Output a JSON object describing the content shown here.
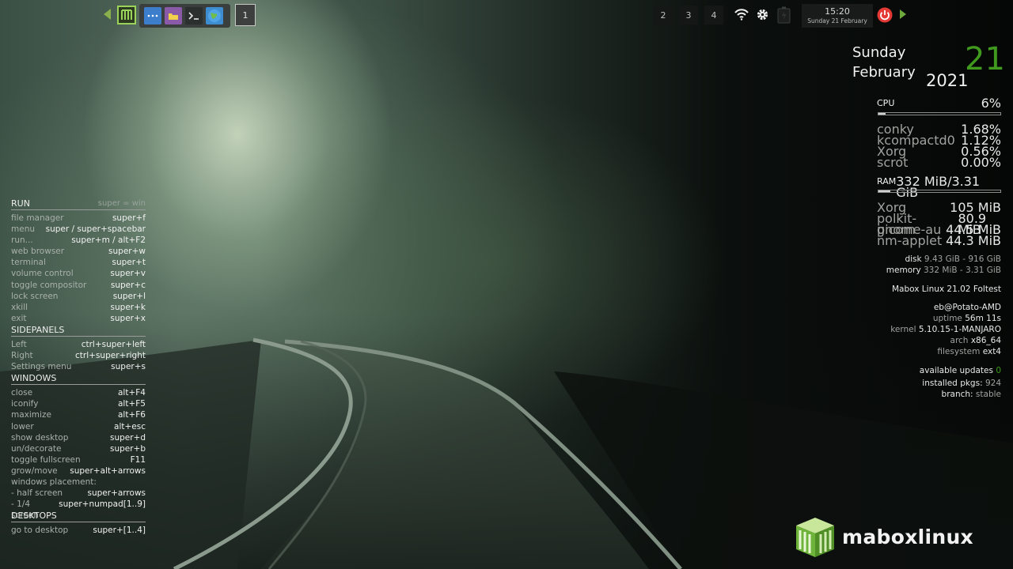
{
  "panel": {
    "workspace_active": "1",
    "workspaces": [
      "2",
      "3",
      "4"
    ],
    "clock_time": "15:20",
    "clock_date": "Sunday 21 February",
    "icons": [
      "mabox-menu-icon",
      "file-manager-icon",
      "folder-icon",
      "terminal-icon",
      "web-browser-icon",
      "wifi-icon",
      "gear-icon",
      "battery-icon",
      "power-icon"
    ]
  },
  "keys": {
    "run": {
      "title": "RUN",
      "hint": "super = win",
      "rows": [
        {
          "a": "file manager",
          "k": "super+f"
        },
        {
          "a": "menu",
          "k": "super / super+spacebar"
        },
        {
          "a": "run...",
          "k": "super+m / alt+F2"
        },
        {
          "a": "web browser",
          "k": "super+w"
        },
        {
          "a": "terminal",
          "k": "super+t"
        },
        {
          "a": "volume control",
          "k": "super+v"
        },
        {
          "a": "toggle compositor",
          "k": "super+c"
        },
        {
          "a": "lock screen",
          "k": "super+l"
        },
        {
          "a": "xkill",
          "k": "super+k"
        },
        {
          "a": "exit",
          "k": "super+x"
        }
      ]
    },
    "sidepanels": {
      "title": "SIDEPANELS",
      "rows": [
        {
          "a": "Left",
          "k": "ctrl+super+left"
        },
        {
          "a": "Right",
          "k": "ctrl+super+right"
        },
        {
          "a": "Settings menu",
          "k": "super+s"
        }
      ]
    },
    "windows": {
      "title": "WINDOWS",
      "rows": [
        {
          "a": "close",
          "k": "alt+F4"
        },
        {
          "a": "iconify",
          "k": "alt+F5"
        },
        {
          "a": "maximize",
          "k": "alt+F6"
        },
        {
          "a": "lower",
          "k": "alt+esc"
        },
        {
          "a": "show desktop",
          "k": "super+d"
        },
        {
          "a": "un/decorate",
          "k": "super+b"
        },
        {
          "a": "toggle fullscreen",
          "k": "F11"
        },
        {
          "a": "grow/move",
          "k": "super+alt+arrows"
        },
        {
          "a": "windows placement:",
          "k": ""
        },
        {
          "a": " - half screen",
          "k": "super+arrows"
        },
        {
          "a": " - 1/4 screen",
          "k": "super+numpad[1..9]"
        }
      ]
    },
    "desktops": {
      "title": "DESKTOPS",
      "rows": [
        {
          "a": "go to desktop",
          "k": "super+[1..4]"
        }
      ]
    }
  },
  "sysinfo": {
    "day": "Sunday",
    "month": "February",
    "year": "2021",
    "daynum": "21",
    "cpu_label": "CPU",
    "cpu_value": "6%",
    "cpu_fraction": 0.06,
    "cpu_procs": [
      {
        "a": "conky",
        "v": "1.68%"
      },
      {
        "a": "kcompactd0",
        "v": "1.12%"
      },
      {
        "a": "Xorg",
        "v": "0.56%"
      },
      {
        "a": "scrot",
        "v": "0.00%"
      }
    ],
    "ram_label": "RAM",
    "ram_value": "332 MiB/3.31 GiB",
    "ram_fraction": 0.1,
    "ram_procs": [
      {
        "a": "Xorg",
        "v": "105 MiB"
      },
      {
        "a": "polkit-gnome-au",
        "v": "80.9 MiB"
      },
      {
        "a": "picom",
        "v": "44.5 MiB"
      },
      {
        "a": "nm-applet",
        "v": "44.3 MiB"
      }
    ],
    "disk_label": "disk",
    "disk_value": "9.43 GiB - 916 GiB",
    "memory_label": "memory",
    "memory_value": "332 MiB - 3.31 GiB",
    "distro": "Mabox Linux 21.02 Foltest",
    "user_host": "eb@Potato-AMD",
    "uptime_label": "uptime",
    "uptime_value": "56m 11s",
    "kernel_label": "kernel",
    "kernel_value": "5.10.15-1-MANJARO",
    "arch_label": "arch",
    "arch_value": "x86_64",
    "fs_label": "filesystem",
    "fs_value": "ext4",
    "updates_label": "available updates",
    "updates_value": "0",
    "pkgs_label": "installed pkgs:",
    "pkgs_value": "924",
    "branch_label": "branch:",
    "branch_value": "stable"
  },
  "logo": {
    "word": "maboxlinux"
  },
  "colors": {
    "accent": "#3f9a1e",
    "mabox_green": "#9bd35a",
    "power_red": "#e53935"
  }
}
